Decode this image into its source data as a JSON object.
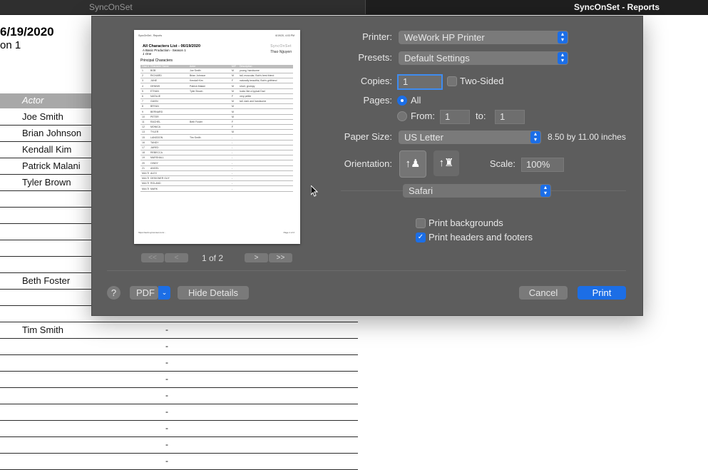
{
  "tabs": {
    "left": "SyncOnSet",
    "right": "SyncOnSet - Reports"
  },
  "report": {
    "title": "6/19/2020",
    "subtitle": "on 1",
    "column_header": "Actor",
    "actors": [
      "Joe Smith",
      "Brian Johnson",
      "Kendall Kim",
      "Patrick Malani",
      "Tyler Brown",
      "",
      "",
      "",
      "",
      "",
      "Beth Foster",
      "",
      "",
      "Tim Smith",
      "",
      "",
      "",
      "",
      "",
      "",
      "",
      ""
    ],
    "dashes": [
      "",
      "",
      "",
      "",
      "",
      "",
      "",
      "",
      "",
      "",
      "",
      "",
      "...",
      "-",
      "-",
      "-",
      "-",
      "-",
      "-",
      "-",
      "-",
      "-"
    ]
  },
  "preview": {
    "title": "All Characters List - 06/19/2020",
    "subtitle": "A Basic Production - Season 1",
    "subtitle2": "1 One",
    "section": "Principal Characters",
    "logo": "SyncOnSet",
    "author": "Thao Nguyen",
    "header_left": "SyncOnSet - Reports",
    "header_right": "6/19/20, 4:03 PM",
    "footer_left": "https://web.synconset.com/...",
    "footer_right": "Page 1 of 2",
    "columns": [
      "Cast #",
      "Character Name",
      "Actor",
      "M/F",
      "Description"
    ],
    "rows": [
      [
        "1",
        "BOB",
        "Joe Smith",
        "M",
        "young, handsome"
      ],
      [
        "2",
        "RICHARD",
        "Brian Johnson",
        "M",
        "tall, muscular, Bob's best friend"
      ],
      [
        "3",
        "JUNE",
        "Kendall Kim",
        "F",
        "naturally beautiful, Bob's girlfriend"
      ],
      [
        "4",
        "DENNIS",
        "Patrick Malani",
        "M",
        "short, grumpy"
      ],
      [
        "5",
        "ETHAN",
        "Tyler Brown",
        "M",
        "looks like a typical Dad"
      ],
      [
        "6",
        "NATALIE",
        "",
        "F",
        "very petite"
      ],
      [
        "7",
        "GAVIN",
        "",
        "M",
        "tall, dark and handsome"
      ],
      [
        "8",
        "BRYAN",
        "",
        "M",
        ""
      ],
      [
        "9",
        "BERNARD",
        "",
        "M",
        ""
      ],
      [
        "10",
        "PETER",
        "",
        "M",
        ""
      ],
      [
        "11",
        "RACHEL",
        "Beth Foster",
        "F",
        ""
      ],
      [
        "12",
        "MONICA",
        "",
        "F",
        ""
      ],
      [
        "13",
        "TYLER",
        "",
        "M",
        ""
      ],
      [
        "15",
        "LANGDON",
        "Tim Smith",
        "-",
        ""
      ],
      [
        "16",
        "TANDY",
        "",
        "-",
        ""
      ],
      [
        "17",
        "JARED",
        "",
        "-",
        ""
      ],
      [
        "18",
        "REBECCA",
        "",
        "-",
        ""
      ],
      [
        "19",
        "MARSHALL",
        "",
        "-",
        ""
      ],
      [
        "20",
        "CINDY",
        "",
        "-",
        ""
      ],
      [
        "21",
        "ANGEL",
        "",
        "-",
        ""
      ],
      [
        "MULTI",
        "ALEX",
        "",
        "-",
        ""
      ],
      [
        "MULTI",
        "DESIGNER GUY",
        "",
        "-",
        ""
      ],
      [
        "MULTI",
        "ROLAND",
        "",
        "-",
        ""
      ],
      [
        "MULTI",
        "MARK",
        "",
        "-",
        ""
      ]
    ]
  },
  "pager": {
    "first": "<<",
    "prev": "<",
    "status": "1 of 2",
    "next": ">",
    "last": ">>"
  },
  "printer": {
    "label": "Printer:",
    "value": "WeWork HP Printer"
  },
  "presets": {
    "label": "Presets:",
    "value": "Default Settings"
  },
  "copies": {
    "label": "Copies:",
    "value": "1",
    "two_sided": "Two-Sided"
  },
  "pages": {
    "label": "Pages:",
    "all": "All",
    "from": "From:",
    "from_value": "1",
    "to": "to:",
    "to_value": "1"
  },
  "paper": {
    "label": "Paper Size:",
    "value": "US Letter",
    "dimensions": "8.50 by 11.00 inches"
  },
  "orientation": {
    "label": "Orientation:",
    "scale_label": "Scale:",
    "scale_value": "100%"
  },
  "app_section": {
    "value": "Safari"
  },
  "options": {
    "backgrounds": "Print backgrounds",
    "headers": "Print headers and footers"
  },
  "footer": {
    "help": "?",
    "pdf": "PDF",
    "hide": "Hide Details",
    "cancel": "Cancel",
    "print": "Print"
  },
  "colors": {
    "accent": "#1c6ee6",
    "dialog": "#5d5d5d"
  }
}
